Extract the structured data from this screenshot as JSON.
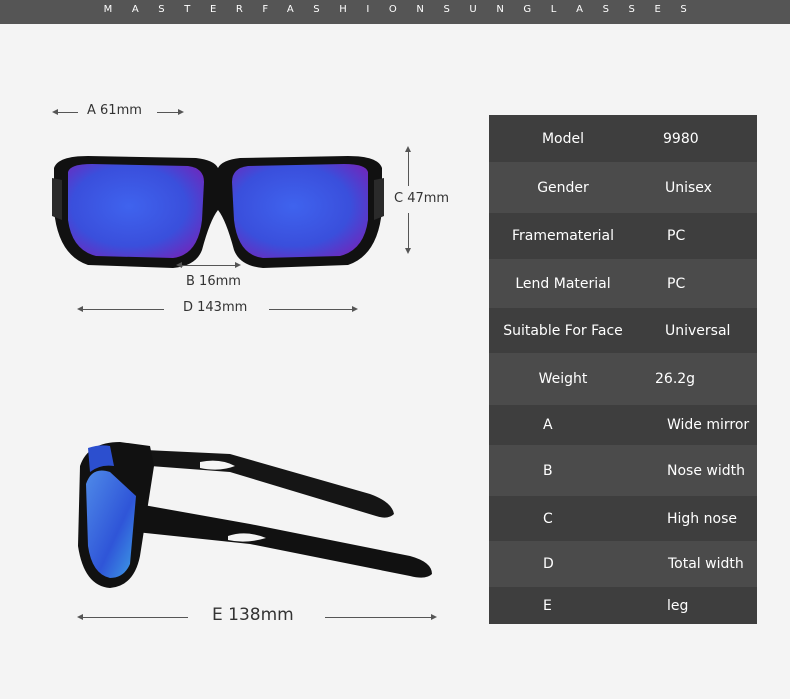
{
  "brand": "MASTERFASHIONSUNGLASSES",
  "dimensions": {
    "a": "A 61mm",
    "b": "B 16mm",
    "c": "C 47mm",
    "d": "D 143mm",
    "e": "E 138mm"
  },
  "specs": [
    {
      "label": "Model",
      "value": "9980"
    },
    {
      "label": "Gender",
      "value": "Unisex"
    },
    {
      "label": "Framematerial",
      "value": "PC"
    },
    {
      "label": "Lend Material",
      "value": "PC"
    },
    {
      "label": "Suitable For Face",
      "value": "Universal"
    },
    {
      "label": "Weight",
      "value": "26.2g"
    },
    {
      "label": "A",
      "value": "Wide mirror"
    },
    {
      "label": "B",
      "value": "Nose width"
    },
    {
      "label": "C",
      "value": "High nose"
    },
    {
      "label": "D",
      "value": "Total width"
    },
    {
      "label": "E",
      "value": "leg"
    }
  ],
  "colors": {
    "header_bar": "#555555",
    "table_bg": "#3e3e3e",
    "table_alt": "#4b4b4b",
    "lens": "#3a55e0",
    "frame": "#111111"
  }
}
